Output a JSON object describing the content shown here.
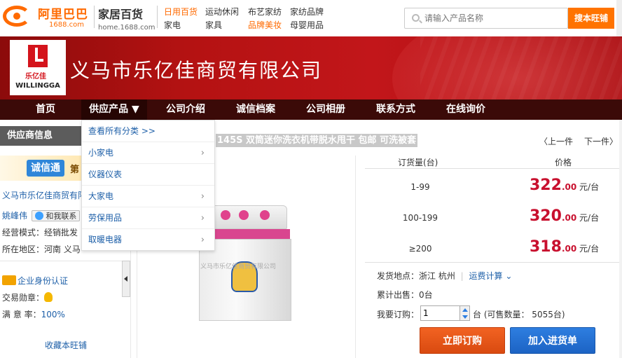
{
  "topbar": {
    "logo_name": "阿里巴巴",
    "logo_domain": "1688.com",
    "channel_title": "家居百货",
    "channel_domain": "home.1688.com",
    "links": [
      {
        "label": "日用百货",
        "highlight": true
      },
      {
        "label": "运动休闲",
        "highlight": false
      },
      {
        "label": "布艺家纺",
        "highlight": false
      },
      {
        "label": "家纺品牌",
        "highlight": false
      },
      {
        "label": "家电",
        "highlight": false
      },
      {
        "label": "家具",
        "highlight": false
      },
      {
        "label": "品牌美妆",
        "highlight": true
      },
      {
        "label": "母婴用品",
        "highlight": false
      }
    ],
    "search_placeholder": "请输入产品名称",
    "search_button": "搜本旺铺"
  },
  "banner": {
    "logo_cn": "乐亿佳",
    "logo_en": "WILLINGGA",
    "company_name": "义马市乐亿佳商贸有限公司"
  },
  "nav": {
    "items": [
      "首页",
      "供应产品 ▼",
      "公司介绍",
      "诚信档案",
      "公司相册",
      "联系方式",
      "在线询价"
    ]
  },
  "dropdown": {
    "items": [
      {
        "label": "查看所有分类 >>",
        "has_arrow": false
      },
      {
        "label": "小家电",
        "has_arrow": true
      },
      {
        "label": "仪器仪表",
        "has_arrow": false
      },
      {
        "label": "大家电",
        "has_arrow": true
      },
      {
        "label": "劳保用品",
        "has_arrow": true
      },
      {
        "label": "取暖电器",
        "has_arrow": true
      }
    ],
    "arrow_glyph": "›"
  },
  "supplier": {
    "title": "供应商信息",
    "badge_logo": "诚信通",
    "badge_suffix": "第",
    "company_short": "义马市乐亿佳商贸有限",
    "person": "姚峰伟",
    "contact_button": "和我联系",
    "mode": "经营模式：经销批发",
    "region": "所在地区：河南 义马",
    "id_auth": "企业身份认证",
    "medal_label": "交易勋章：",
    "rate_label": "满 意 率：",
    "rate_value": "100%",
    "favorite": "收藏本旺铺"
  },
  "product": {
    "title": "145S 双筒迷你洗衣机带脱水甩干 包邮 可洗被套",
    "prev": "〈上一件",
    "next": "下一件〉",
    "image_watermark": "义马市乐亿佳商贸有限公司",
    "col_qty": "订货量(台)",
    "col_price": "价格",
    "tiers": [
      {
        "qty": "1-99",
        "price_int": "322",
        "price_dec": ".00",
        "unit": "元/台"
      },
      {
        "qty": "100-199",
        "price_int": "320",
        "price_dec": ".00",
        "unit": "元/台"
      },
      {
        "qty": "≥200",
        "price_int": "318",
        "price_dec": ".00",
        "unit": "元/台"
      }
    ],
    "ship_label": "发货地点：浙江 杭州",
    "freight_link": "运费计算",
    "sold_label": "累计出售：0台",
    "order_label": "我要订购：",
    "order_qty": "1",
    "stock_label": "台 (可售数量： 5055台)",
    "buy_button": "立即订购",
    "cart_button": "加入进货单"
  }
}
